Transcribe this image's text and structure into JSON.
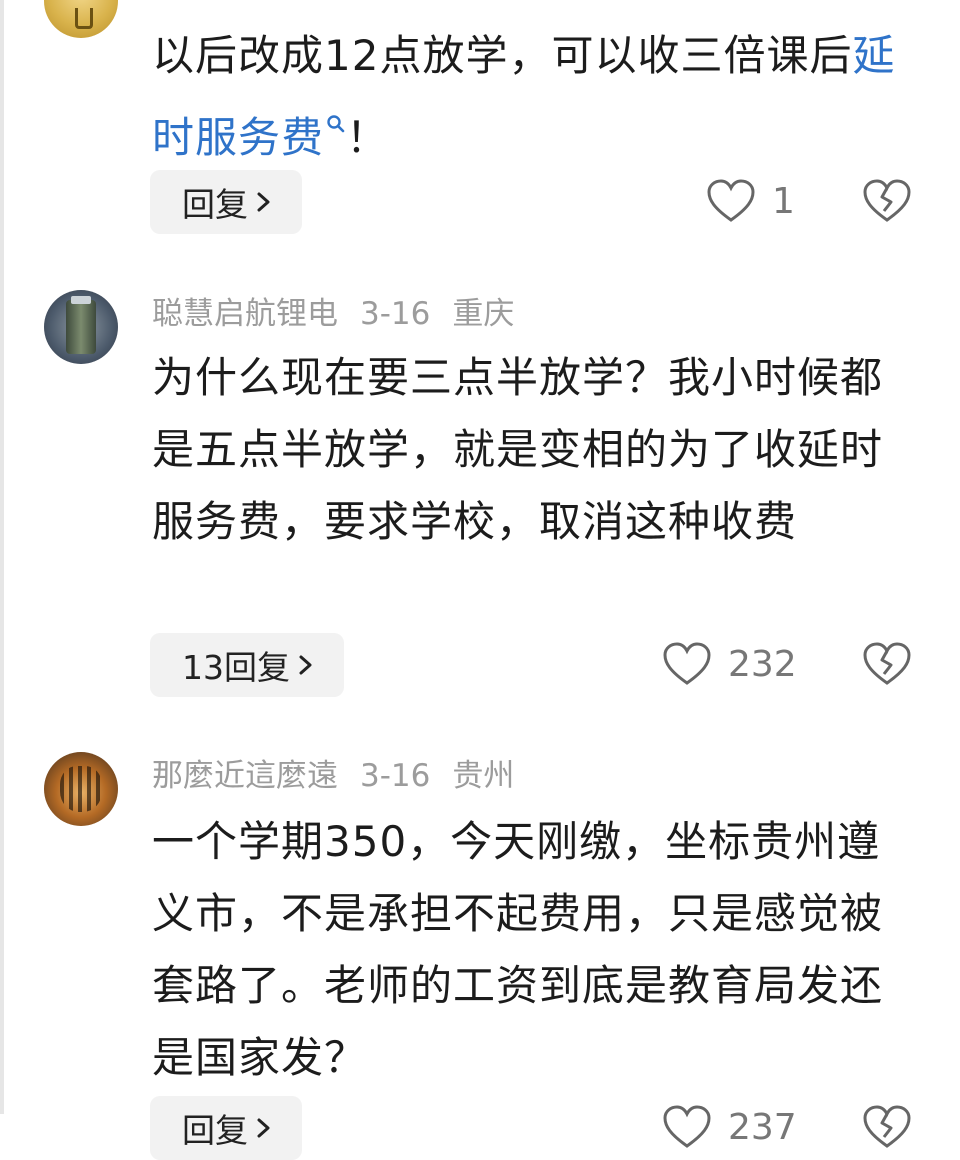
{
  "comments": [
    {
      "author": "",
      "date": "",
      "location": "",
      "text_plain": "以后改成12点放学，可以收三倍课后",
      "text_link": "延时服务费",
      "text_after": "！",
      "reply_label": "回复",
      "likes": "1"
    },
    {
      "author": "聪慧启航锂电",
      "date": "3-16",
      "location": "重庆",
      "text": "为什么现在要三点半放学？我小时候都是五点半放学，就是变相的为了收延时服务费，要求学校，取消这种收费",
      "reply_label": "13回复",
      "likes": "232"
    },
    {
      "author": "那麼近這麼遠",
      "date": "3-16",
      "location": "贵州",
      "text": "一个学期350，今天刚缴，坐标贵州遵义市，不是承担不起费用，只是感觉被套路了。老师的工资到底是教育局发还是国家发？",
      "reply_label": "回复",
      "likes": "237"
    }
  ],
  "icons": {
    "heart": "heart-outline-icon",
    "dislike": "broken-heart-icon",
    "chevron": "chevron-right-icon",
    "search": "search-icon"
  },
  "colors": {
    "link": "#2f73c9",
    "meta": "#9c9c9c",
    "reply_bg": "#f2f2f2"
  }
}
